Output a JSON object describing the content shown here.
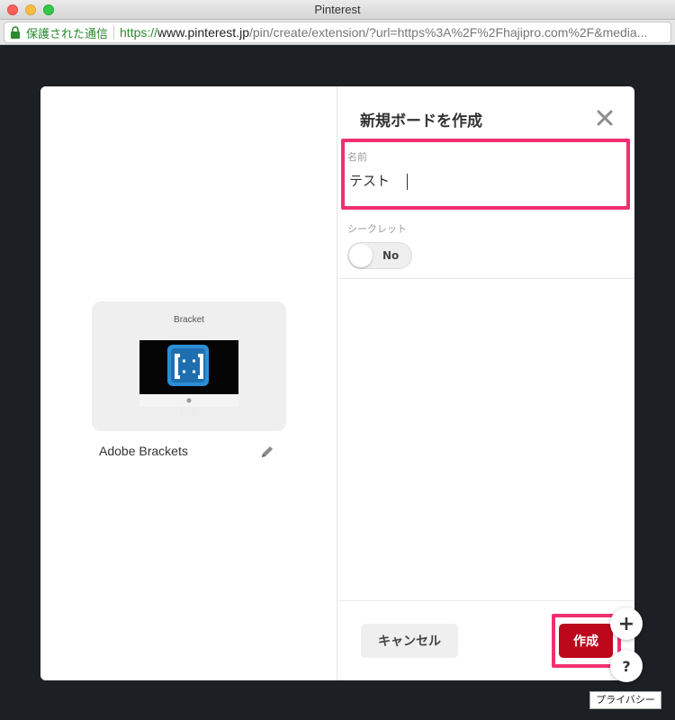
{
  "window": {
    "title": "Pinterest"
  },
  "address_bar": {
    "security_text": "保護された通信",
    "url_protocol": "https://",
    "url_host": "www.pinterest.jp",
    "url_path": "/pin/create/extension/?url=https%3A%2F%2Fhajipro.com%2F&media..."
  },
  "pin_preview": {
    "image_caption": "Bracket",
    "title": "Adobe Brackets"
  },
  "board_form": {
    "heading": "新規ボードを作成",
    "name_label": "名前",
    "name_value": "テスト",
    "secret_label": "シークレット",
    "secret_toggle_text": "No",
    "cancel_label": "キャンセル",
    "create_label": "作成"
  },
  "floating": {
    "plus_label": "+",
    "help_label": "?",
    "tooltip": "プライバシー"
  },
  "colors": {
    "primary_button": "#bd081c",
    "highlight_box": "#f0306f",
    "secure_green": "#2a8a2f"
  }
}
